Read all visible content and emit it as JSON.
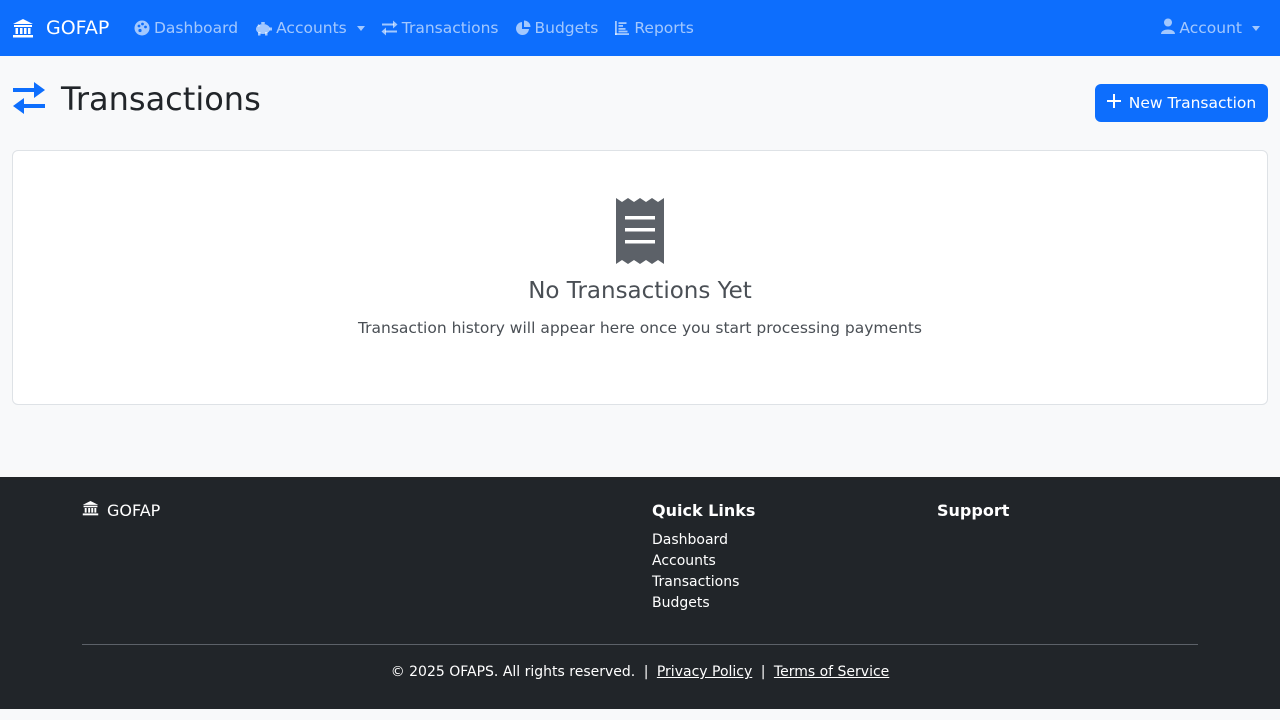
{
  "navbar": {
    "brand": "GOFAP",
    "items": [
      {
        "label": "Dashboard",
        "icon": "palette-icon"
      },
      {
        "label": "Accounts",
        "icon": "piggy-bank-icon",
        "dropdown": true
      },
      {
        "label": "Transactions",
        "icon": "exchange-icon"
      },
      {
        "label": "Budgets",
        "icon": "pie-chart-icon"
      },
      {
        "label": "Reports",
        "icon": "bar-chart-icon"
      }
    ],
    "account_label": "Account"
  },
  "page": {
    "title": "Transactions",
    "new_button_label": "New Transaction"
  },
  "empty_state": {
    "icon": "receipt-icon",
    "title": "No Transactions Yet",
    "subtitle": "Transaction history will appear here once you start processing payments"
  },
  "footer": {
    "brand": "GOFAP",
    "quick_links_heading": "Quick Links",
    "quick_links": [
      "Dashboard",
      "Accounts",
      "Transactions",
      "Budgets"
    ],
    "support_heading": "Support",
    "copyright": "© 2025 OFAPS. All rights reserved.",
    "separator": "|",
    "privacy_label": "Privacy Policy",
    "terms_label": "Terms of Service"
  },
  "colors": {
    "primary": "#0d6efd",
    "footer_bg": "#212529",
    "page_bg": "#f8f9fa"
  }
}
